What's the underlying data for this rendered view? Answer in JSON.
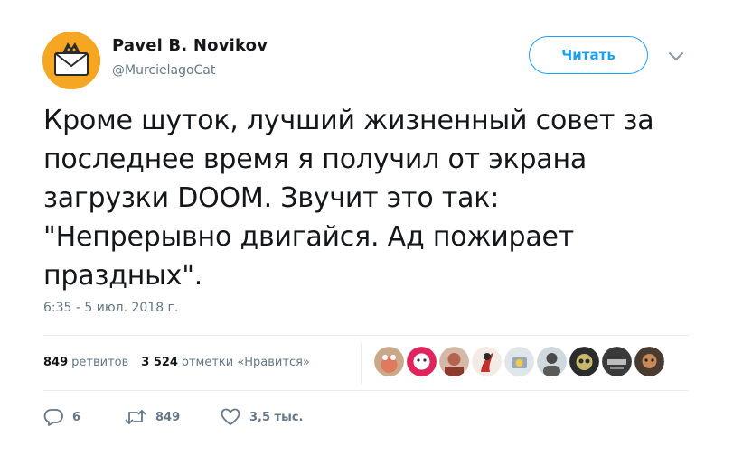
{
  "author": {
    "name": "Pavel B. Novikov",
    "handle": "@MurcielagoCat"
  },
  "follow_button": {
    "label": "Читать"
  },
  "tweet": {
    "lines": [
      "Кроме шуток, лучший жизненный совет за",
      "последнее время я получил от экрана",
      "загрузки DOOM. Звучит это так:",
      "\"Непрерывно двигайся. Ад пожирает",
      "праздных\"."
    ],
    "timestamp": "6:35 - 5 июл. 2018 г."
  },
  "stats": {
    "retweets_count": "849",
    "retweets_label": "ретвитов",
    "likes_count": "3 524",
    "likes_label": "отметки «Нравится»"
  },
  "actions": {
    "reply_count": "6",
    "retweet_count": "849",
    "like_count": "3,5 тыс."
  },
  "colors": {
    "accent": "#1da1f2",
    "text": "#14171a",
    "secondary": "#657786",
    "divider": "#e6ecf0",
    "avatar_bg": "#f5a623"
  },
  "icons": {
    "reply": "speech-bubble-icon",
    "retweet": "retweet-arrows-icon",
    "like": "heart-icon",
    "menu": "chevron-down-icon"
  }
}
